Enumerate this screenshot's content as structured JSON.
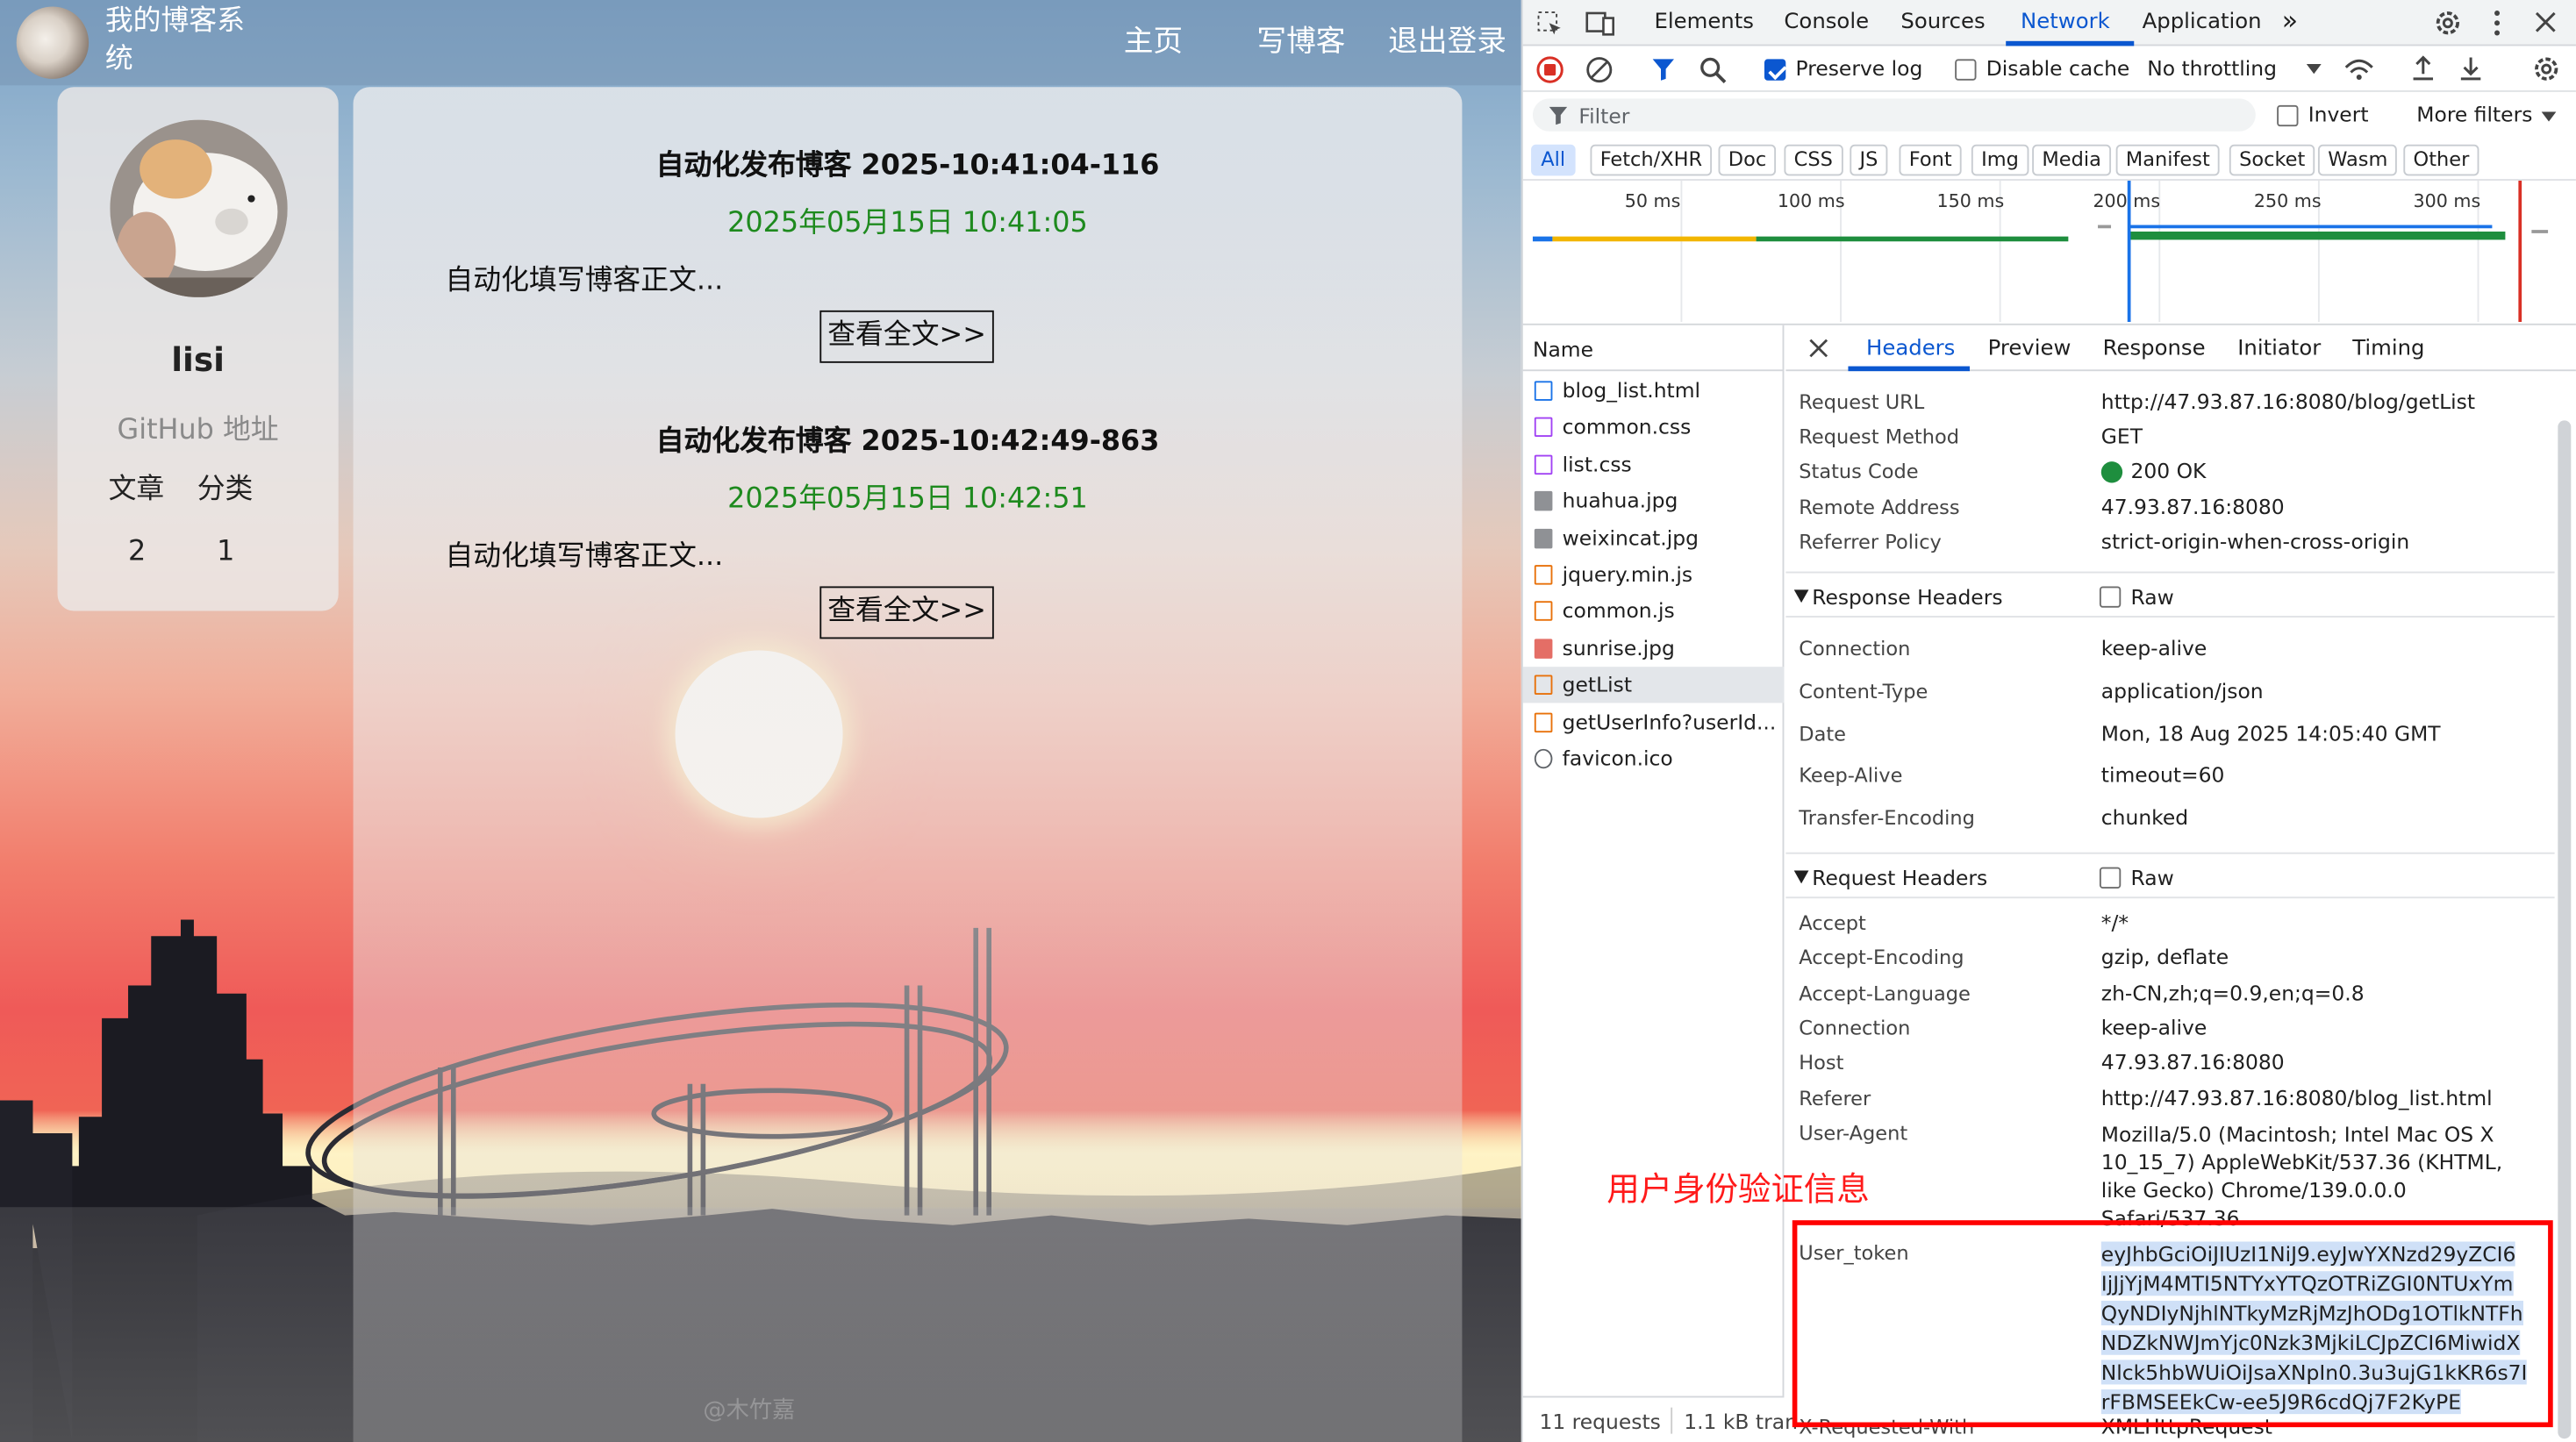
{
  "blog": {
    "site_title": "我的博客系统",
    "nav": [
      "主页",
      "写博客",
      "退出登录"
    ],
    "profile": {
      "username": "lisi",
      "github": "GitHub 地址",
      "stat_labels": [
        "文章",
        "分类"
      ],
      "stat_values": [
        "2",
        "1"
      ]
    },
    "posts": [
      {
        "title": "自动化发布博客 2025-10:41:04-116",
        "date": "2025年05月15日 10:41:05",
        "desc": "自动化填写博客正文...",
        "btn": "查看全文>>"
      },
      {
        "title": "自动化发布博客 2025-10:42:49-863",
        "date": "2025年05月15日 10:42:51",
        "desc": "自动化填写博客正文...",
        "btn": "查看全文>>"
      }
    ],
    "watermark": "@木竹嘉"
  },
  "devtools": {
    "tabs": [
      "Elements",
      "Console",
      "Sources",
      "Network",
      "Application"
    ],
    "active_tab": "Network",
    "toolbar": {
      "preserve_log": "Preserve log",
      "disable_cache": "Disable cache",
      "throttling": "No throttling"
    },
    "filter": {
      "placeholder": "Filter",
      "invert": "Invert",
      "more_filters": "More filters"
    },
    "type_filters": [
      "All",
      "Fetch/XHR",
      "Doc",
      "CSS",
      "JS",
      "Font",
      "Img",
      "Media",
      "Manifest",
      "Socket",
      "Wasm",
      "Other"
    ],
    "timeline_ticks": [
      "50 ms",
      "100 ms",
      "150 ms",
      "200 ms",
      "250 ms",
      "300 ms"
    ],
    "name_header": "Name",
    "files": [
      {
        "name": "blog_list.html",
        "type": "doc",
        "color": "#1a73e8"
      },
      {
        "name": "common.css",
        "type": "css",
        "color": "#a142f4"
      },
      {
        "name": "list.css",
        "type": "css",
        "color": "#a142f4"
      },
      {
        "name": "huahua.jpg",
        "type": "img",
        "color": "#5f6368"
      },
      {
        "name": "weixincat.jpg",
        "type": "img",
        "color": "#5f6368"
      },
      {
        "name": "jquery.min.js",
        "type": "js",
        "color": "#e8710a"
      },
      {
        "name": "common.js",
        "type": "js",
        "color": "#e8710a"
      },
      {
        "name": "sunrise.jpg",
        "type": "img",
        "color": "#d93025"
      },
      {
        "name": "getList",
        "type": "xhr",
        "color": "#e8710a"
      },
      {
        "name": "getUserInfo?userId...",
        "type": "xhr",
        "color": "#e8710a"
      },
      {
        "name": "favicon.ico",
        "type": "other",
        "color": "#5f6368"
      }
    ],
    "status": {
      "requests": "11 requests",
      "transferred": "1.1 kB tran"
    },
    "detail_tabs": [
      "Headers",
      "Preview",
      "Response",
      "Initiator",
      "Timing"
    ],
    "general": [
      {
        "k": "Request URL",
        "v": "http://47.93.87.16:8080/blog/getList"
      },
      {
        "k": "Request Method",
        "v": "GET"
      },
      {
        "k": "Status Code",
        "v": "200 OK"
      },
      {
        "k": "Remote Address",
        "v": "47.93.87.16:8080"
      },
      {
        "k": "Referrer Policy",
        "v": "strict-origin-when-cross-origin"
      }
    ],
    "response_headers_title": "Response Headers",
    "raw": "Raw",
    "response_headers": [
      {
        "k": "Connection",
        "v": "keep-alive"
      },
      {
        "k": "Content-Type",
        "v": "application/json"
      },
      {
        "k": "Date",
        "v": "Mon, 18 Aug 2025 14:05:40 GMT"
      },
      {
        "k": "Keep-Alive",
        "v": "timeout=60"
      },
      {
        "k": "Transfer-Encoding",
        "v": "chunked"
      }
    ],
    "request_headers_title": "Request Headers",
    "request_headers": [
      {
        "k": "Accept",
        "v": "*/*"
      },
      {
        "k": "Accept-Encoding",
        "v": "gzip, deflate"
      },
      {
        "k": "Accept-Language",
        "v": "zh-CN,zh;q=0.9,en;q=0.8"
      },
      {
        "k": "Connection",
        "v": "keep-alive"
      },
      {
        "k": "Host",
        "v": "47.93.87.16:8080"
      },
      {
        "k": "Referer",
        "v": "http://47.93.87.16:8080/blog_list.html"
      },
      {
        "k": "User-Agent",
        "v": "Mozilla/5.0 (Macintosh; Intel Mac OS X 10_15_7) AppleWebKit/537.36 (KHTML, like Gecko) Chrome/139.0.0.0 Safari/537.36"
      },
      {
        "k": "User_token",
        "v": "eyJhbGciOiJIUzI1NiJ9.eyJwYXNzd29yZCI6IjJjYjM4MTI5NTYxYTQzOTRiZGI0NTUxYmQyNDIyNjhlNTkyMzRjMzJhODg1OTlkNTFhNDZkNWJmYjc0Nzk3MjkiLCJpZCI6MiwidXNlck5hbWUiOiJsaXNpIn0.3u3ujG1kKR6s7IrFBMSEEkCw-ee5J9R6cdQj7F2KyPE"
      },
      {
        "k": "X-Requested-With",
        "v": "XMLHttpRequest"
      }
    ],
    "user_agent_lines": [
      "Mozilla/5.0 (Macintosh; Intel Mac OS X",
      "10_15_7) AppleWebKit/537.36 (KHTML,",
      "like Gecko) Chrome/139.0.0.0",
      "Safari/537.36"
    ],
    "token_lines": [
      "eyJhbGciOiJIUzI1NiJ9.eyJwYXNzd29yZCI6",
      "IjJjYjM4MTI5NTYxYTQzOTRiZGI0NTUxYm",
      "QyNDIyNjhlNTkyMzRjMzJhODg1OTlkNTFh",
      "NDZkNWJmYjc0Nzk3MjkiLCJpZCI6MiwidX",
      "Nlck5hbWUiOiJsaXNpIn0.3u3ujG1kKR6s7I",
      "rFBMSEEkCw-ee5J9R6cdQj7F2KyPE"
    ]
  },
  "annotation": "用户身份验证信息",
  "colors": {
    "accent": "#0b57d0",
    "annotation_red": "#ff0000",
    "post_date_green": "#1e8a1e",
    "status_ok": "#1e8e3e"
  }
}
